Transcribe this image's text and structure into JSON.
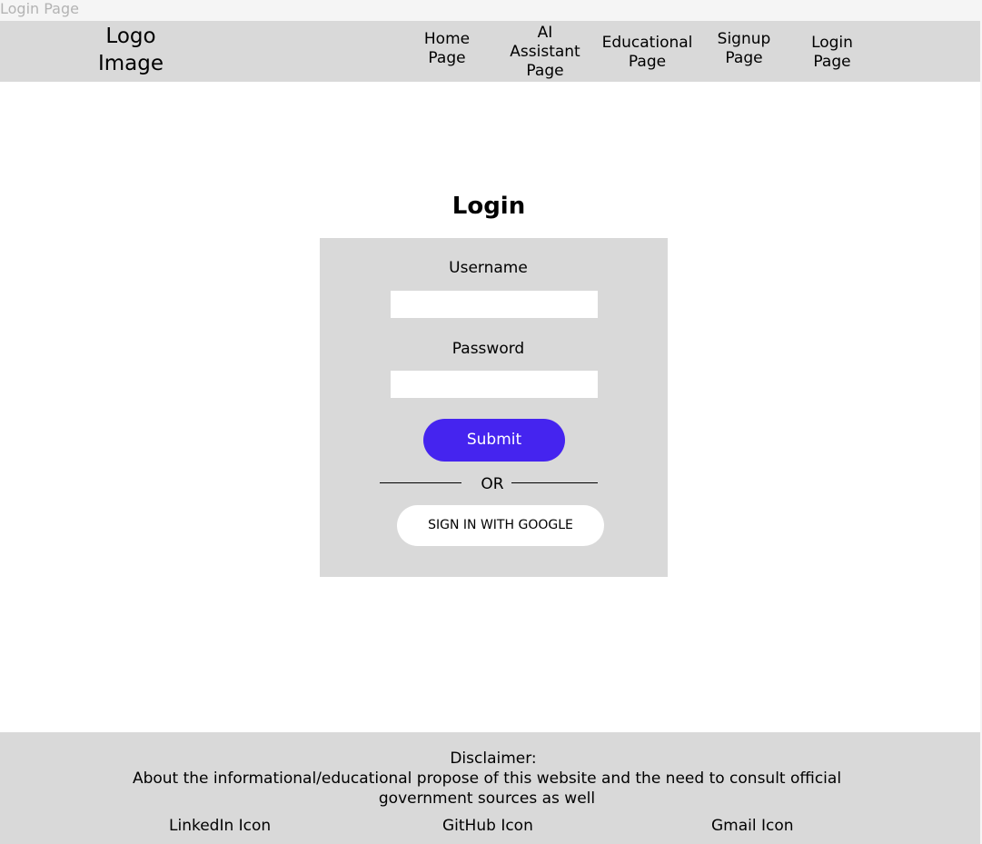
{
  "frame_label": "Login Page",
  "header": {
    "logo_text": "Logo Image",
    "nav": [
      {
        "label": "Home Page"
      },
      {
        "label": "AI Assistant Page"
      },
      {
        "label": "Educational Page"
      },
      {
        "label": "Signup Page"
      },
      {
        "label": "Login Page"
      }
    ]
  },
  "main": {
    "title": "Login",
    "username_label": "Username",
    "username_value": "",
    "password_label": "Password",
    "password_value": "",
    "submit_label": "Submit",
    "or_label": "OR",
    "google_label": "SIGN IN WITH GOOGLE",
    "accent_color": "#4524ef"
  },
  "footer": {
    "disclaimer_title": "Disclaimer:",
    "disclaimer_text": "About the informational/educational propose of this website and the need to consult official government sources as well",
    "links": [
      {
        "label": "LinkedIn Icon"
      },
      {
        "label": "GitHub Icon"
      },
      {
        "label": "Gmail Icon"
      }
    ]
  }
}
